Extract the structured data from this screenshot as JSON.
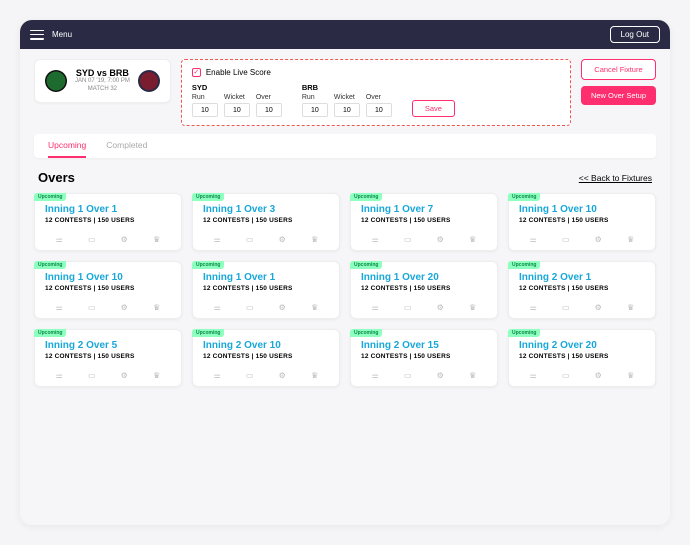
{
  "topbar": {
    "menu_label": "Menu",
    "logout_label": "Log Out"
  },
  "match": {
    "title": "SYD vs BRB",
    "date": "JAN 07 '19, 7:00 PM",
    "match_no": "MATCH 32"
  },
  "score": {
    "enable_label": "Enable Live Score",
    "teams": [
      {
        "name": "SYD",
        "run": "10",
        "wicket": "10",
        "over": "10"
      },
      {
        "name": "BRB",
        "run": "10",
        "wicket": "10",
        "over": "10"
      }
    ],
    "headers": {
      "run": "Run",
      "wicket": "Wicket",
      "over": "Over"
    },
    "save_label": "Save"
  },
  "actions": {
    "cancel": "Cancel Fixture",
    "new_over": "New Over Setup"
  },
  "tabs": {
    "upcoming": "Upcoming",
    "completed": "Completed"
  },
  "overs": {
    "title": "Overs",
    "back": "<< Back to Fixtures"
  },
  "card_common": {
    "sub": "12 CONTESTS | 150 USERS",
    "tag": "Upcoming"
  },
  "cards": [
    {
      "title": "Inning 1 Over 1"
    },
    {
      "title": "Inning 1 Over 3"
    },
    {
      "title": "Inning 1 Over 7"
    },
    {
      "title": "Inning 1 Over 10"
    },
    {
      "title": "Inning 1 Over 10"
    },
    {
      "title": "Inning 1 Over 1"
    },
    {
      "title": "Inning 1 Over 20"
    },
    {
      "title": "Inning 2 Over 1"
    },
    {
      "title": "Inning 2 Over 5"
    },
    {
      "title": "Inning 2 Over 10"
    },
    {
      "title": "Inning 2 Over 15"
    },
    {
      "title": "Inning 2 Over 20"
    }
  ]
}
